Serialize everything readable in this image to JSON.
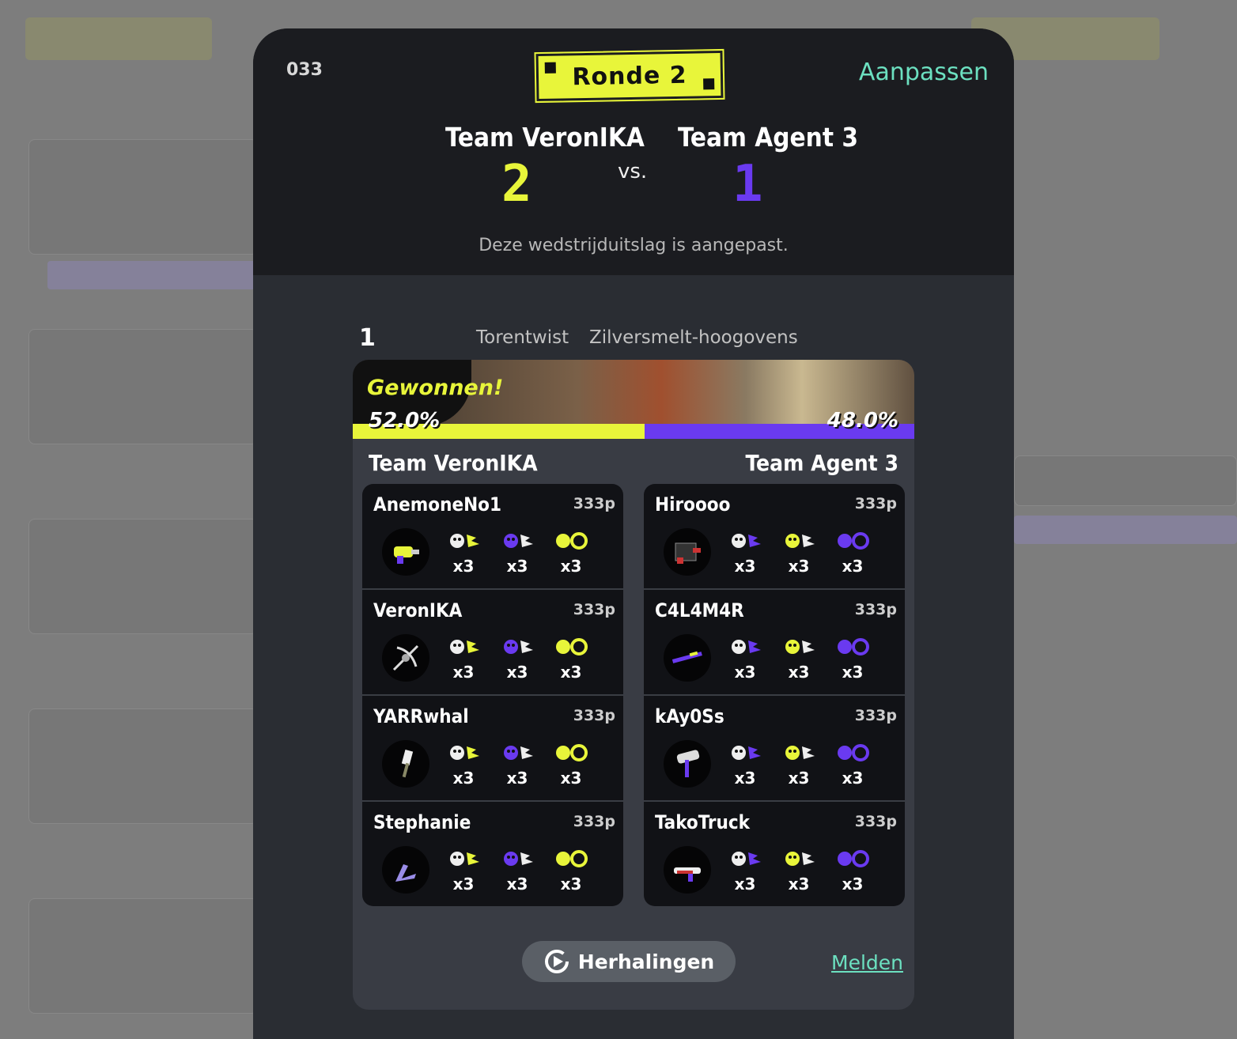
{
  "header": {
    "match_id": "033",
    "round_label": "Ronde 2",
    "edit_label": "Aanpassen",
    "vs_label": "vs.",
    "note": "Deze wedstrijduitslag is aangepast."
  },
  "teams": {
    "a": {
      "name": "Team VeronIKA",
      "score": "2",
      "color": "#e8f53a"
    },
    "b": {
      "name": "Team Agent 3",
      "score": "1",
      "color": "#6a3af0"
    }
  },
  "game": {
    "index": "1",
    "mode": "Torentwist",
    "stage": "Zilversmelt-hoogovens",
    "result_label": "Gewonnen!",
    "pct_a": "52.0%",
    "pct_b": "48.0%",
    "share_a": 0.52,
    "share_b": 0.48
  },
  "players_a": [
    {
      "name": "AnemoneNo1",
      "points": "333p",
      "weapon": "blaster-weapon-icon",
      "special": "ink-vac-icon",
      "stats": [
        "x3",
        "x3",
        "x3"
      ]
    },
    {
      "name": "VeronIKA",
      "points": "333p",
      "weapon": "stringer-weapon-icon",
      "special": "tenta-missiles-icon",
      "stats": [
        "x3",
        "x3",
        "x3"
      ]
    },
    {
      "name": "YARRwhal",
      "points": "333p",
      "weapon": "brush-weapon-icon",
      "special": "zipcaster-icon",
      "stats": [
        "x3",
        "x3",
        "x3"
      ]
    },
    {
      "name": "Stephanie",
      "points": "333p",
      "weapon": "dualies-weapon-icon",
      "special": "triple-inkstrike-icon",
      "stats": [
        "x3",
        "x3",
        "x3"
      ]
    }
  ],
  "players_b": [
    {
      "name": "Hiroooo",
      "points": "333p",
      "weapon": "brella-weapon-icon",
      "special": "tenta-missiles-icon",
      "stats": [
        "x3",
        "x3",
        "x3"
      ]
    },
    {
      "name": "C4L4M4R",
      "points": "333p",
      "weapon": "charger-weapon-icon",
      "special": "booyah-bomb-icon",
      "stats": [
        "x3",
        "x3",
        "x3"
      ]
    },
    {
      "name": "kAy0Ss",
      "points": "333p",
      "weapon": "roller-weapon-icon",
      "special": "ultra-stamp-icon",
      "stats": [
        "x3",
        "x3",
        "x3"
      ]
    },
    {
      "name": "TakoTruck",
      "points": "333p",
      "weapon": "splattershot-weapon-icon",
      "special": "crab-tank-icon",
      "stats": [
        "x3",
        "x3",
        "x3"
      ]
    }
  ],
  "footer": {
    "replay_label": "Herhalingen",
    "report_label": "Melden"
  }
}
